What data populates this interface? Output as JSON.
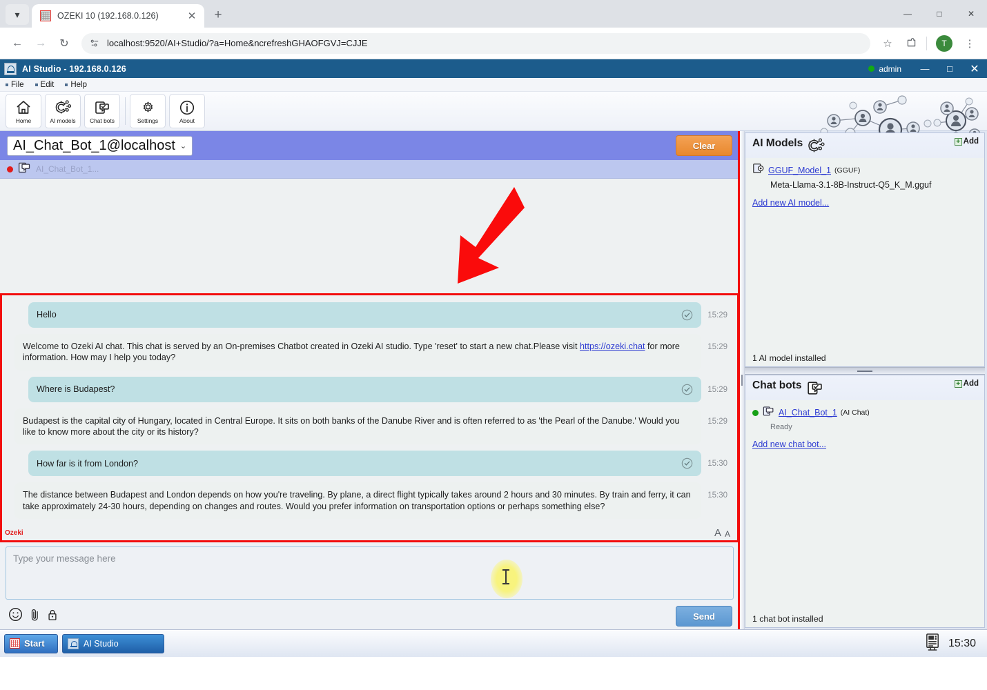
{
  "browser": {
    "tab": {
      "title": "OZEKI 10 (192.168.0.126)",
      "favicon": "grid-icon",
      "close": "✕"
    },
    "new_tab": "+",
    "tab_list": "⌄",
    "window_controls": {
      "minimize": "—",
      "maximize": "□",
      "close": "✕"
    },
    "nav": {
      "back": "←",
      "forward": "→",
      "reload": "↻"
    },
    "omnibox": {
      "url": "localhost:9520/AI+Studio/?a=Home&ncrefreshGHAOFGVJ=CJJE",
      "site_icon": "site-settings-icon"
    },
    "actions": {
      "bookmark": "☆",
      "extensions": "extensions-icon",
      "profile": "T",
      "menu": "⋮"
    }
  },
  "app": {
    "title_name": "AI Studio",
    "title_dash": "-",
    "title_host": "192.168.0.126",
    "user": "admin",
    "window_controls": {
      "minimize": "—",
      "maximize": "□",
      "close": "✕"
    },
    "menus": [
      "File",
      "Edit",
      "Help"
    ],
    "toolbar": [
      {
        "label": "Home",
        "icon": "home-icon"
      },
      {
        "label": "AI models",
        "icon": "ai-models-gear-icon"
      },
      {
        "label": "Chat bots",
        "icon": "chat-bots-icon"
      },
      {
        "label": "Settings",
        "icon": "gear-icon"
      },
      {
        "label": "About",
        "icon": "info-icon"
      }
    ]
  },
  "chat": {
    "bot_selector": "AI_Chat_Bot_1@localhost",
    "bot_selector_caret": "⌄",
    "clear_label": "Clear",
    "subheader_label": "AI_Chat_Bot_1...",
    "messages": [
      {
        "from": "user",
        "text": "Hello",
        "time": "15:29",
        "status": "delivered-check"
      },
      {
        "from": "bot",
        "text_before": "Welcome to Ozeki AI chat. This chat is served by an On-premises Chatbot created in Ozeki AI studio. Type 'reset' to start a new chat.Please visit ",
        "link": "https://ozeki.chat",
        "text_after": " for more information. How may I help you today?",
        "time": "15:29"
      },
      {
        "from": "user",
        "text": "Where is Budapest?",
        "time": "15:29",
        "status": "delivered-check"
      },
      {
        "from": "bot",
        "text_before": "Budapest is the capital city of Hungary, located in Central Europe. It sits on both banks of the Danube River and is often referred to as 'the Pearl of the Danube.' Would you like to know more about the city or its history?",
        "link": "",
        "text_after": "",
        "time": "15:29"
      },
      {
        "from": "user",
        "text": "How far is it from London?",
        "time": "15:30",
        "status": "delivered-check"
      },
      {
        "from": "bot",
        "text_before": "The distance between Budapest and London depends on how you're traveling. By plane, a direct flight typically takes around 2 hours and 30 minutes. By train and ferry, it can take approximately 24-30 hours, depending on changes and routes. Would you prefer information on transportation options or perhaps something else?",
        "link": "",
        "text_after": "",
        "time": "15:30"
      }
    ],
    "watermark": "Ozeki",
    "font_size_big": "A",
    "font_size_small": "A",
    "composer_placeholder": "Type your message here",
    "composer_value": "",
    "send_label": "Send",
    "tools": {
      "emoji": "emoji-icon",
      "attach": "paperclip-icon",
      "lock": "lock-icon"
    }
  },
  "ai_models": {
    "title": "AI Models",
    "add_label": "Add",
    "add_plus": "+",
    "items": [
      {
        "name": "GGUF_Model_1",
        "type": "(GGUF)",
        "detail": "Meta-Llama-3.1-8B-Instruct-Q5_K_M.gguf"
      }
    ],
    "add_new_link": "Add new AI model...",
    "footer": "1 AI model installed"
  },
  "chat_bots": {
    "title": "Chat bots",
    "add_label": "Add",
    "add_plus": "+",
    "items": [
      {
        "name": "AI_Chat_Bot_1",
        "type": "(AI Chat)",
        "status": "Ready"
      }
    ],
    "add_new_link": "Add new chat bot...",
    "footer": "1 chat bot installed"
  },
  "taskbar": {
    "start_label": "Start",
    "task_label": "AI Studio",
    "clock": "15:30",
    "tray_icon": "network-monitor-icon"
  },
  "colors": {
    "app_titlebar": "#1c5c8c",
    "chat_header": "#7b86e6",
    "user_bubble": "#bfe0e4",
    "bot_bubble": "#edf1f0",
    "clear_button": "#e8882e",
    "send_button": "#5b97d1",
    "link": "#2b39d1",
    "highlight_box": "#f20d0d",
    "status_green": "#15a015"
  }
}
